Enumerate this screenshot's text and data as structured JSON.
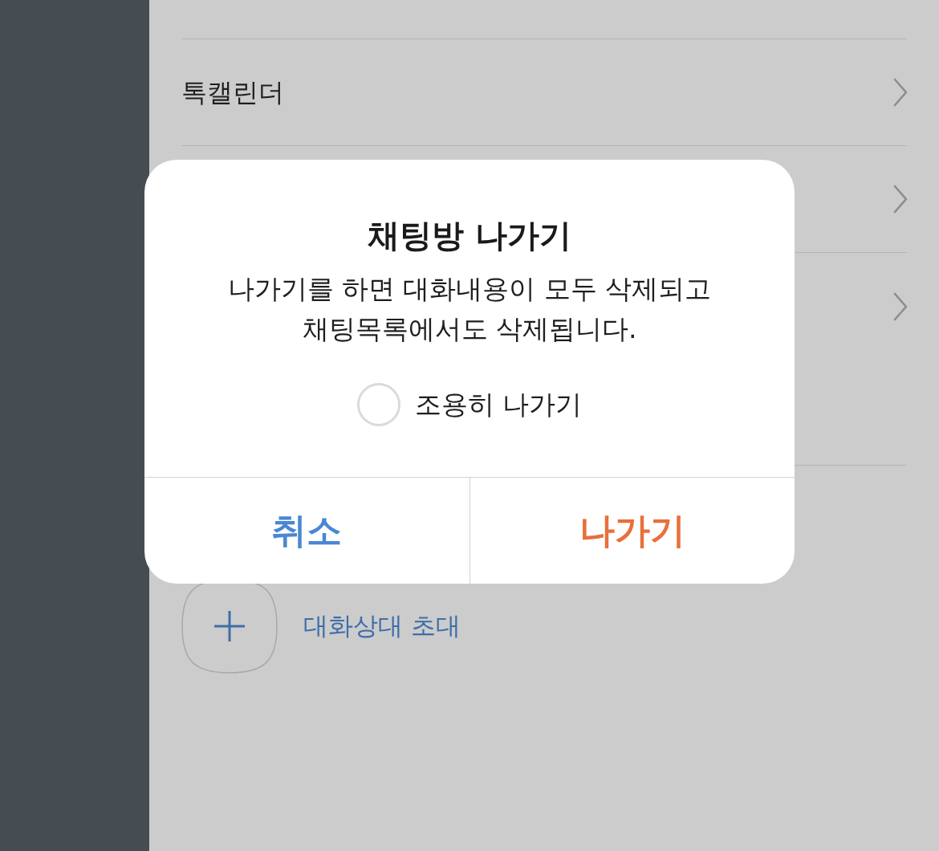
{
  "drawer": {
    "rows": [
      {
        "label": "톡캘린더",
        "chevron": true
      },
      {
        "chevron": true
      },
      {
        "chevron": true
      }
    ],
    "invite": {
      "label": "대화상대 초대"
    }
  },
  "dialog": {
    "title": "채팅방 나가기",
    "message": "나가기를 하면 대화내용이 모두 삭제되고\n채팅목록에서도 삭제됩니다.",
    "option": {
      "label": "조용히 나가기",
      "checked": false
    },
    "buttons": [
      {
        "label": "취소",
        "kind": "cancel"
      },
      {
        "label": "나가기",
        "kind": "confirm"
      }
    ]
  }
}
